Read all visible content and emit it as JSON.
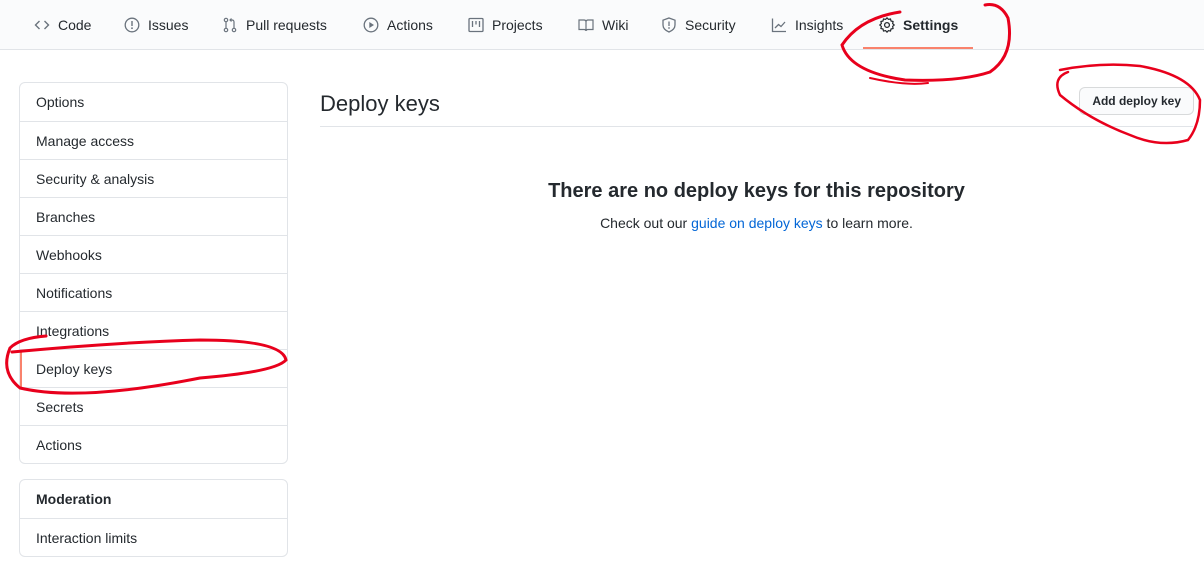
{
  "nav": {
    "tabs": [
      {
        "label": "Code",
        "icon": "code-icon"
      },
      {
        "label": "Issues",
        "icon": "issue-icon"
      },
      {
        "label": "Pull requests",
        "icon": "pull-request-icon"
      },
      {
        "label": "Actions",
        "icon": "play-icon"
      },
      {
        "label": "Projects",
        "icon": "project-icon"
      },
      {
        "label": "Wiki",
        "icon": "book-icon"
      },
      {
        "label": "Security",
        "icon": "shield-icon"
      },
      {
        "label": "Insights",
        "icon": "graph-icon"
      },
      {
        "label": "Settings",
        "icon": "gear-icon",
        "selected": true
      }
    ],
    "selected_color": "#f9826c"
  },
  "sidebar": {
    "items": [
      {
        "label": "Options"
      },
      {
        "label": "Manage access"
      },
      {
        "label": "Security & analysis"
      },
      {
        "label": "Branches"
      },
      {
        "label": "Webhooks"
      },
      {
        "label": "Notifications"
      },
      {
        "label": "Integrations"
      },
      {
        "label": "Deploy keys",
        "selected": true
      },
      {
        "label": "Secrets"
      },
      {
        "label": "Actions"
      }
    ],
    "moderation": {
      "heading": "Moderation",
      "items": [
        {
          "label": "Interaction limits"
        }
      ]
    }
  },
  "main": {
    "title": "Deploy keys",
    "add_button_label": "Add deploy key",
    "blankslate": {
      "heading": "There are no deploy keys for this repository",
      "text_before": "Check out our ",
      "link_text": "guide on deploy keys",
      "text_after": " to learn more."
    },
    "link_color": "#0366d6"
  },
  "annotations": {
    "color": "#e8001c",
    "marks": [
      "circle-settings-tab",
      "circle-add-deploy-key-button",
      "circle-deploy-keys-sidebar-item"
    ]
  }
}
